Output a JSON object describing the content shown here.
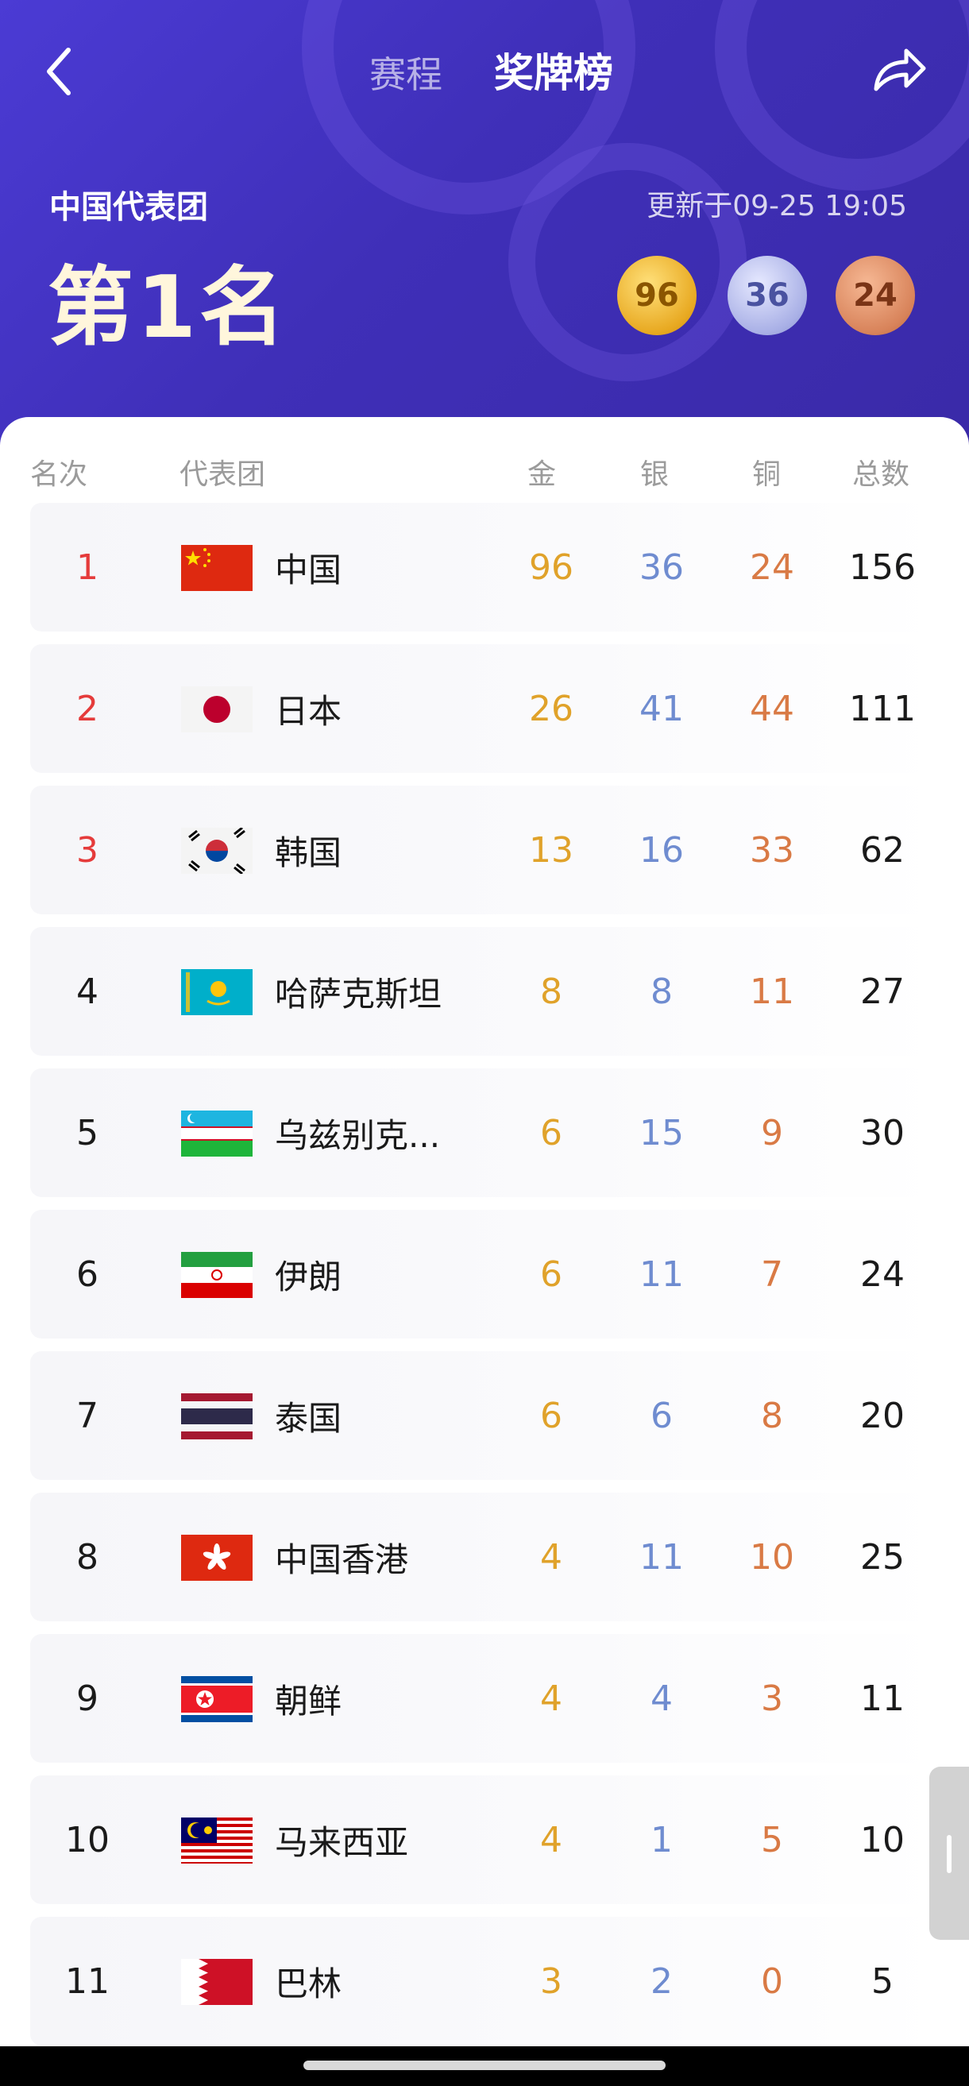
{
  "header": {
    "tabs": [
      "赛程",
      "奖牌榜"
    ],
    "active_tab": "奖牌榜",
    "team_name": "中国代表团",
    "update_time": "更新于09-25 19:05",
    "rank_text": "第1名",
    "medals": {
      "gold": "96",
      "silver": "36",
      "bronze": "24"
    }
  },
  "table": {
    "headers": {
      "rank": "名次",
      "team": "代表团",
      "gold": "金",
      "silver": "银",
      "bronze": "铜",
      "total": "总数"
    },
    "rows": [
      {
        "rank": "1",
        "name": "中国",
        "gold": "96",
        "silver": "36",
        "bronze": "24",
        "total": "156",
        "flag": "china-flag"
      },
      {
        "rank": "2",
        "name": "日本",
        "gold": "26",
        "silver": "41",
        "bronze": "44",
        "total": "111",
        "flag": "japan-flag"
      },
      {
        "rank": "3",
        "name": "韩国",
        "gold": "13",
        "silver": "16",
        "bronze": "33",
        "total": "62",
        "flag": "korea-flag"
      },
      {
        "rank": "4",
        "name": "哈萨克斯坦",
        "gold": "8",
        "silver": "8",
        "bronze": "11",
        "total": "27",
        "flag": "kazakhstan-flag"
      },
      {
        "rank": "5",
        "name": "乌兹别克...",
        "gold": "6",
        "silver": "15",
        "bronze": "9",
        "total": "30",
        "flag": "uzbekistan-flag"
      },
      {
        "rank": "6",
        "name": "伊朗",
        "gold": "6",
        "silver": "11",
        "bronze": "7",
        "total": "24",
        "flag": "iran-flag"
      },
      {
        "rank": "7",
        "name": "泰国",
        "gold": "6",
        "silver": "6",
        "bronze": "8",
        "total": "20",
        "flag": "thailand-flag"
      },
      {
        "rank": "8",
        "name": "中国香港",
        "gold": "4",
        "silver": "11",
        "bronze": "10",
        "total": "25",
        "flag": "hongkong-flag"
      },
      {
        "rank": "9",
        "name": "朝鲜",
        "gold": "4",
        "silver": "4",
        "bronze": "3",
        "total": "11",
        "flag": "dprk-flag"
      },
      {
        "rank": "10",
        "name": "马来西亚",
        "gold": "4",
        "silver": "1",
        "bronze": "5",
        "total": "10",
        "flag": "malaysia-flag"
      },
      {
        "rank": "11",
        "name": "巴林",
        "gold": "3",
        "silver": "2",
        "bronze": "0",
        "total": "5",
        "flag": "bahrain-flag"
      }
    ]
  },
  "colors": {
    "header_bg": "#4b3bd4",
    "gold": "#e0a22a",
    "silver": "#6f8cd0",
    "bronze": "#d97a45",
    "top_rank": "#e53b3b"
  },
  "icons": {
    "back": "chevron-left-icon",
    "share": "share-icon"
  }
}
